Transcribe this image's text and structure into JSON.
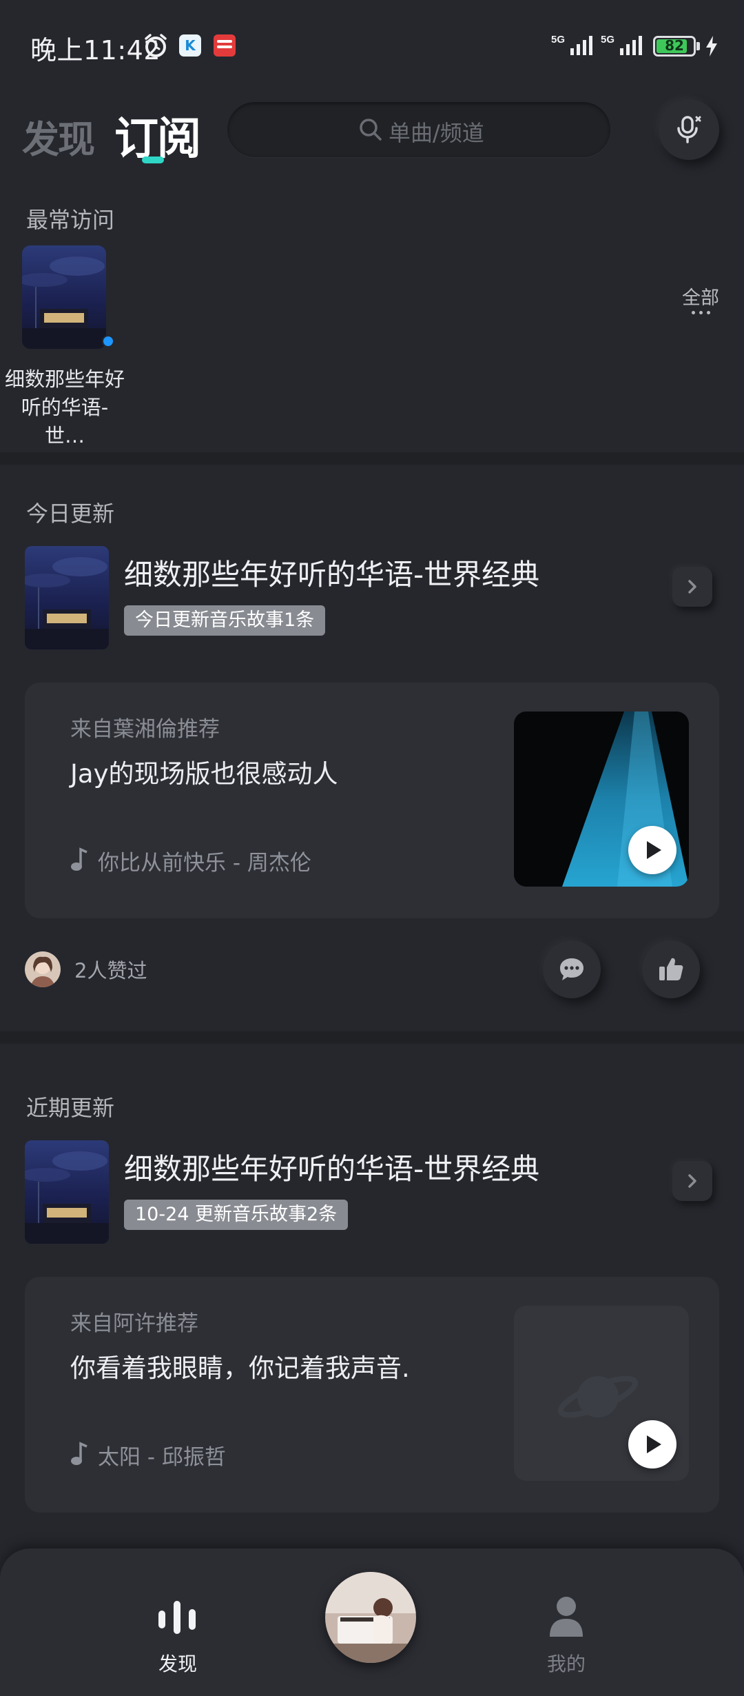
{
  "status_bar": {
    "time": "晚上11:42",
    "network_1": "5G",
    "network_2": "5G",
    "battery": "82",
    "icons": [
      "alarm-icon",
      "app-k-icon",
      "app-news-icon",
      "signal-icon",
      "battery-icon",
      "charging-icon"
    ]
  },
  "header": {
    "tab_discover": "发现",
    "tab_subscribe": "订阅",
    "active_tab": "订阅",
    "accent": "#2fd6c6",
    "search_placeholder": "单曲/频道"
  },
  "most_visited": {
    "title": "最常访问",
    "items": [
      {
        "label": "细数那些年好听的华语-世界经典",
        "label_display": "细数那些年好\n听的华语-世…"
      }
    ],
    "all_label": "全部"
  },
  "today": {
    "title": "今日更新",
    "channel_title": "细数那些年好听的华语-世界经典",
    "badge": "今日更新音乐故事1条",
    "rec": {
      "from": "来自葉湘倫推荐",
      "text": "Jay的现场版也很感动人",
      "song": "你比从前快乐 - 周杰伦"
    },
    "likes": "2人赞过"
  },
  "recent": {
    "title": "近期更新",
    "channel_title": "细数那些年好听的华语-世界经典",
    "badge": "10-24 更新音乐故事2条",
    "rec": {
      "from": "来自阿许推荐",
      "text": "你看着我眼睛，你记着我声音.",
      "song": "太阳 - 邱振哲"
    }
  },
  "bottom_nav": {
    "discover": "发现",
    "mine": "我的"
  }
}
